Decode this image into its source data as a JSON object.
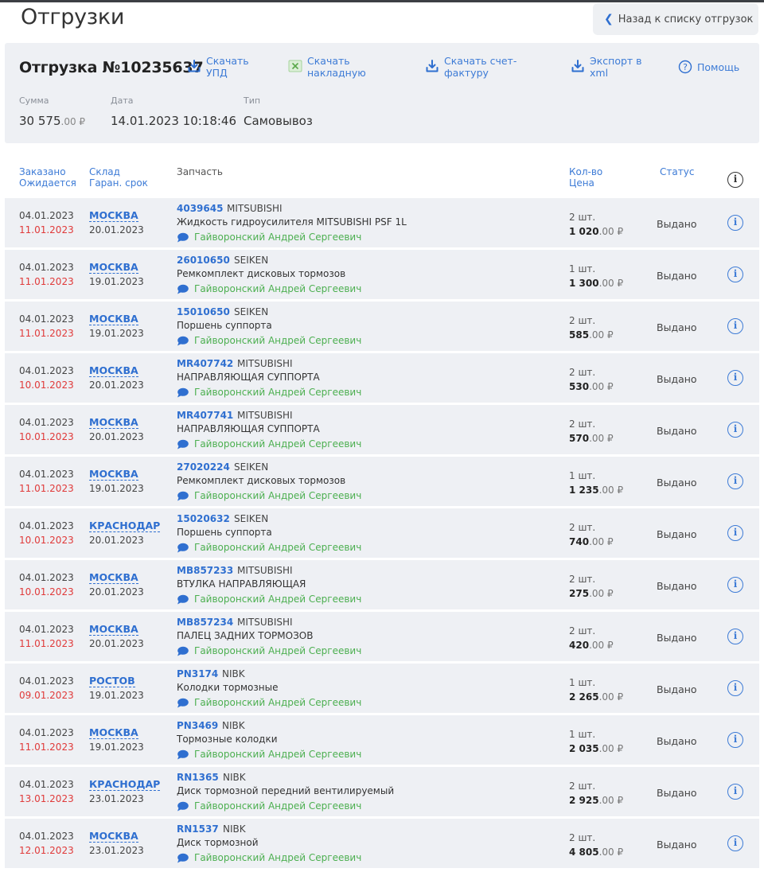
{
  "page": {
    "title": "Отгрузки"
  },
  "back_button": {
    "label": "Назад к списку отгрузок"
  },
  "shipment": {
    "title": "Отгрузка №10235637",
    "actions": {
      "upd": {
        "line1": "Скачать",
        "line2": "УПД"
      },
      "invoice": {
        "line1": "Скачать",
        "line2": "накладную"
      },
      "facture": {
        "line1": "Скачать счет-",
        "line2": "фактуру"
      },
      "xml": {
        "line1": "Экспорт в",
        "line2": "xml"
      },
      "help": {
        "label": "Помощь"
      }
    },
    "labels": {
      "sum": "Сумма",
      "date": "Дата",
      "type": "Тип"
    },
    "sum_main": "30 575",
    "sum_dec": ".00 ₽",
    "date": "14.01.2023 10:18:46",
    "type": "Самовывоз"
  },
  "table": {
    "headers": {
      "ordered": "Заказано",
      "expected": "Ожидается",
      "warehouse": "Склад",
      "guarantee": "Гаран. срок",
      "part": "Запчасть",
      "qty": "Кол-во",
      "price": "Цена",
      "status": "Статус"
    },
    "rows": [
      {
        "ordered": "04.01.2023",
        "expected": "11.01.2023",
        "warehouse": "МОСКВА",
        "guarantee": "20.01.2023",
        "code": "4039645",
        "brand": "MITSUBISHI",
        "name": "Жидкость гидроусилителя MITSUBISHI PSF 1L",
        "manager": "Гайворонский Андрей Сергеевич",
        "qty": "2 шт.",
        "price_main": "1 020",
        "price_dec": ".00 ₽",
        "status": "Выдано"
      },
      {
        "ordered": "04.01.2023",
        "expected": "11.01.2023",
        "warehouse": "МОСКВА",
        "guarantee": "19.01.2023",
        "code": "26010650",
        "brand": "SEIKEN",
        "name": "Ремкомплект дисковых тормозов",
        "manager": "Гайворонский Андрей Сергеевич",
        "qty": "1 шт.",
        "price_main": "1 300",
        "price_dec": ".00 ₽",
        "status": "Выдано"
      },
      {
        "ordered": "04.01.2023",
        "expected": "11.01.2023",
        "warehouse": "МОСКВА",
        "guarantee": "19.01.2023",
        "code": "15010650",
        "brand": "SEIKEN",
        "name": "Поршень суппорта",
        "manager": "Гайворонский Андрей Сергеевич",
        "qty": "2 шт.",
        "price_main": "585",
        "price_dec": ".00 ₽",
        "status": "Выдано"
      },
      {
        "ordered": "04.01.2023",
        "expected": "10.01.2023",
        "warehouse": "МОСКВА",
        "guarantee": "20.01.2023",
        "code": "MR407742",
        "brand": "MITSUBISHI",
        "name": "НАПРАВЛЯЮЩАЯ СУППОРТА",
        "manager": "Гайворонский Андрей Сергеевич",
        "qty": "2 шт.",
        "price_main": "530",
        "price_dec": ".00 ₽",
        "status": "Выдано"
      },
      {
        "ordered": "04.01.2023",
        "expected": "10.01.2023",
        "warehouse": "МОСКВА",
        "guarantee": "20.01.2023",
        "code": "MR407741",
        "brand": "MITSUBISHI",
        "name": "НАПРАВЛЯЮЩАЯ СУППОРТА",
        "manager": "Гайворонский Андрей Сергеевич",
        "qty": "2 шт.",
        "price_main": "570",
        "price_dec": ".00 ₽",
        "status": "Выдано"
      },
      {
        "ordered": "04.01.2023",
        "expected": "11.01.2023",
        "warehouse": "МОСКВА",
        "guarantee": "19.01.2023",
        "code": "27020224",
        "brand": "SEIKEN",
        "name": "Ремкомплект дисковых тормозов",
        "manager": "Гайворонский Андрей Сергеевич",
        "qty": "1 шт.",
        "price_main": "1 235",
        "price_dec": ".00 ₽",
        "status": "Выдано"
      },
      {
        "ordered": "04.01.2023",
        "expected": "10.01.2023",
        "warehouse": "КРАСНОДАР",
        "guarantee": "20.01.2023",
        "code": "15020632",
        "brand": "SEIKEN",
        "name": "Поршень суппорта",
        "manager": "Гайворонский Андрей Сергеевич",
        "qty": "2 шт.",
        "price_main": "740",
        "price_dec": ".00 ₽",
        "status": "Выдано"
      },
      {
        "ordered": "04.01.2023",
        "expected": "10.01.2023",
        "warehouse": "МОСКВА",
        "guarantee": "20.01.2023",
        "code": "MB857233",
        "brand": "MITSUBISHI",
        "name": "ВТУЛКА НАПРАВЛЯЮЩАЯ",
        "manager": "Гайворонский Андрей Сергеевич",
        "qty": "2 шт.",
        "price_main": "275",
        "price_dec": ".00 ₽",
        "status": "Выдано"
      },
      {
        "ordered": "04.01.2023",
        "expected": "11.01.2023",
        "warehouse": "МОСКВА",
        "guarantee": "20.01.2023",
        "code": "MB857234",
        "brand": "MITSUBISHI",
        "name": "ПАЛЕЦ ЗАДНИХ ТОРМОЗОВ",
        "manager": "Гайворонский Андрей Сергеевич",
        "qty": "2 шт.",
        "price_main": "420",
        "price_dec": ".00 ₽",
        "status": "Выдано"
      },
      {
        "ordered": "04.01.2023",
        "expected": "09.01.2023",
        "warehouse": "РОСТОВ",
        "guarantee": "19.01.2023",
        "code": "PN3174",
        "brand": "NIBK",
        "name": "Колодки тормозные",
        "manager": "Гайворонский Андрей Сергеевич",
        "qty": "1 шт.",
        "price_main": "2 265",
        "price_dec": ".00 ₽",
        "status": "Выдано"
      },
      {
        "ordered": "04.01.2023",
        "expected": "11.01.2023",
        "warehouse": "МОСКВА",
        "guarantee": "19.01.2023",
        "code": "PN3469",
        "brand": "NIBK",
        "name": "Тормозные колодки",
        "manager": "Гайворонский Андрей Сергеевич",
        "qty": "1 шт.",
        "price_main": "2 035",
        "price_dec": ".00 ₽",
        "status": "Выдано"
      },
      {
        "ordered": "04.01.2023",
        "expected": "13.01.2023",
        "warehouse": "КРАСНОДАР",
        "guarantee": "23.01.2023",
        "code": "RN1365",
        "brand": "NIBK",
        "name": "Диск тормозной передний вентилируемый",
        "manager": "Гайворонский Андрей Сергеевич",
        "qty": "2 шт.",
        "price_main": "2 925",
        "price_dec": ".00 ₽",
        "status": "Выдано"
      },
      {
        "ordered": "04.01.2023",
        "expected": "12.01.2023",
        "warehouse": "МОСКВА",
        "guarantee": "23.01.2023",
        "code": "RN1537",
        "brand": "NIBK",
        "name": "Диск тормозной",
        "manager": "Гайворонский Андрей Сергеевич",
        "qty": "2 шт.",
        "price_main": "4 805",
        "price_dec": ".00 ₽",
        "status": "Выдано"
      }
    ]
  },
  "icons": {
    "download": "download-icon",
    "excel": "excel-icon",
    "help": "help-circle-icon",
    "info": "info-icon",
    "comment": "comment-bubble-icon",
    "back": "chevron-left-icon"
  },
  "colors": {
    "accent": "#2f6fd0",
    "link": "#3d7bd6",
    "overdue": "#e03a3a",
    "manager": "#4caf50",
    "card_bg": "#eef0f4"
  }
}
